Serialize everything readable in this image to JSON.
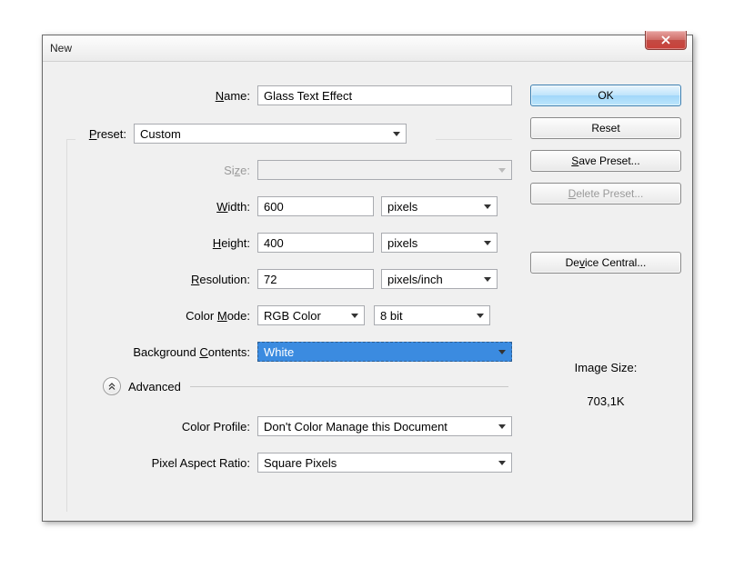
{
  "window": {
    "title": "New"
  },
  "fields": {
    "name_label": "Name:",
    "name_value": "Glass Text Effect",
    "preset_label": "Preset:",
    "preset_value": "Custom",
    "size_label": "Size:",
    "size_value": "",
    "width_label": "Width:",
    "width_value": "600",
    "width_unit": "pixels",
    "height_label": "Height:",
    "height_value": "400",
    "height_unit": "pixels",
    "resolution_label": "Resolution:",
    "resolution_value": "72",
    "resolution_unit": "pixels/inch",
    "colormode_label": "Color Mode:",
    "colormode_value": "RGB Color",
    "colordepth_value": "8 bit",
    "bg_label": "Background Contents:",
    "bg_value": "White",
    "advanced_label": "Advanced",
    "profile_label": "Color Profile:",
    "profile_value": "Don't Color Manage this Document",
    "par_label": "Pixel Aspect Ratio:",
    "par_value": "Square Pixels"
  },
  "buttons": {
    "ok": "OK",
    "reset": "Reset",
    "save_preset": "Save Preset...",
    "delete_preset": "Delete Preset...",
    "device_central": "Device Central..."
  },
  "info": {
    "image_size_label": "Image Size:",
    "image_size_value": "703,1K"
  },
  "accel": {
    "name": "N",
    "preset": "P",
    "size": "z",
    "width": "W",
    "height": "H",
    "resolution": "R",
    "mode": "M",
    "contents": "C",
    "save": "S",
    "delete": "D",
    "device": "D"
  }
}
